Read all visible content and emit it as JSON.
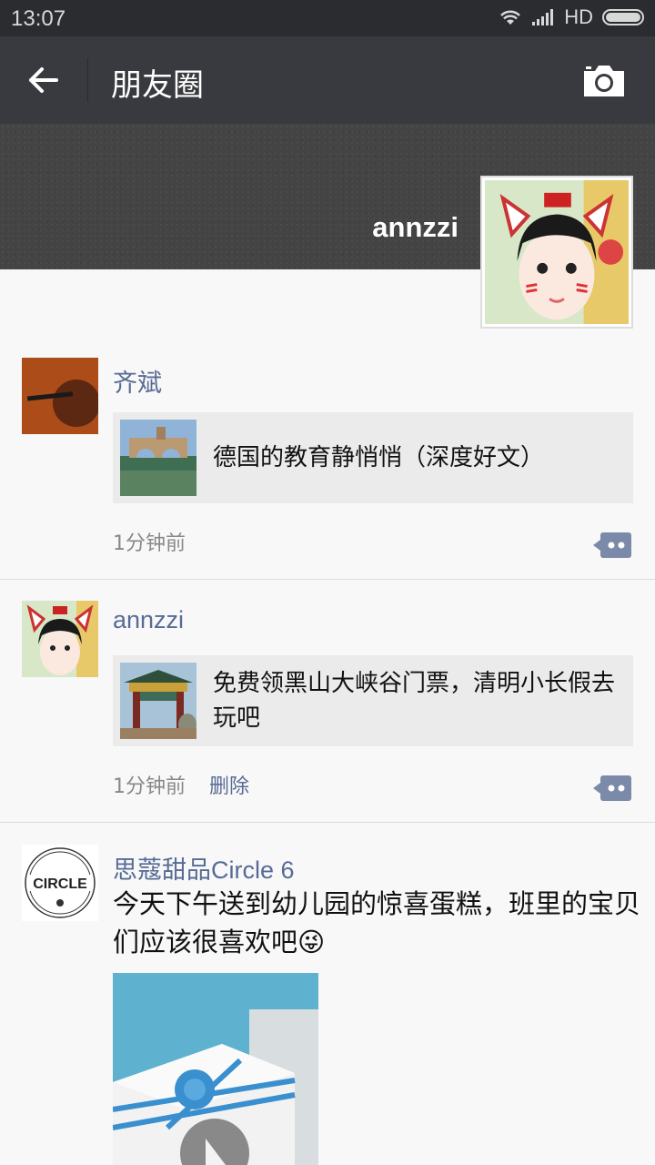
{
  "status_bar": {
    "time": "13:07",
    "network": "HD"
  },
  "header": {
    "title": "朋友圈",
    "back_icon": "arrow-left-icon",
    "camera_icon": "camera-icon"
  },
  "profile": {
    "nickname": "annzzi"
  },
  "posts": [
    {
      "author": "齐斌",
      "share_title": "德国的教育静悄悄（深度好文）",
      "time": "1分钟前"
    },
    {
      "author": "annzzi",
      "share_title": "免费领黑山大峡谷门票，清明小长假去玩吧",
      "time": "1分钟前",
      "delete_label": "删除"
    },
    {
      "author": "思蔻甜品Circle 6",
      "text": "今天下午送到幼儿园的惊喜蛋糕，班里的宝贝们应该很喜欢吧😜",
      "logo_text": "CIRCLE"
    }
  ],
  "colors": {
    "topbar": "#393a3f",
    "link": "#576b95",
    "statusbar": "#2a2c30"
  }
}
